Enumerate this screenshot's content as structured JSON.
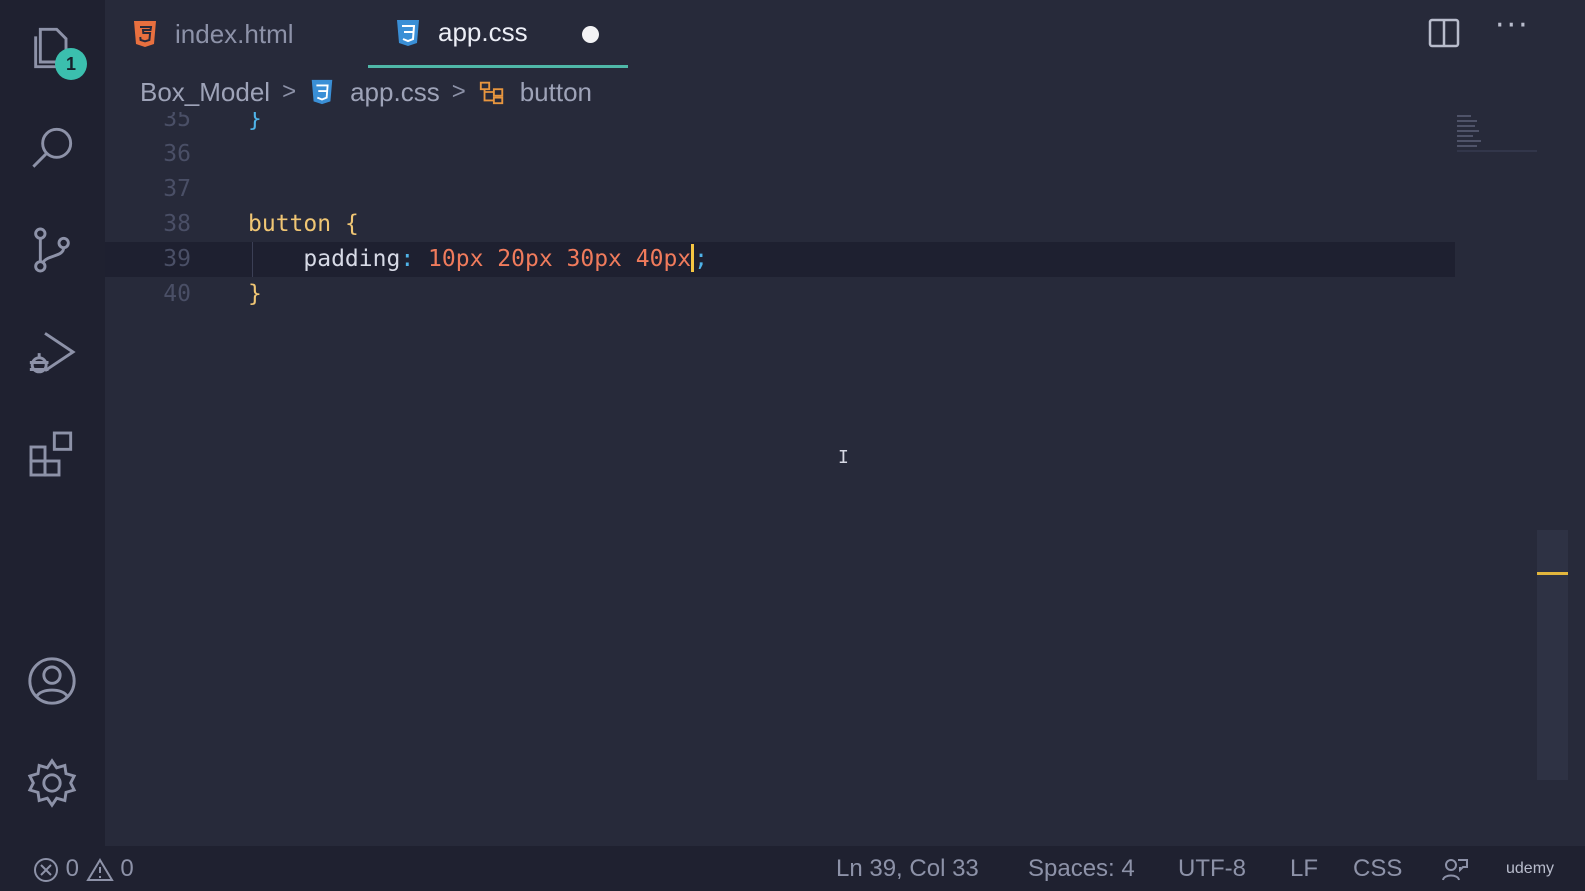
{
  "tabs": [
    {
      "label": "index.html",
      "icon": "html5-icon",
      "active": false
    },
    {
      "label": "app.css",
      "icon": "css3-icon",
      "active": true,
      "dirty": true
    }
  ],
  "activity_bar": {
    "items": [
      "explorer-icon",
      "search-icon",
      "source-control-icon",
      "run-debug-icon",
      "extensions-icon"
    ],
    "bottom": [
      "account-icon",
      "settings-gear-icon"
    ],
    "explorer_badge": "1"
  },
  "breadcrumb": [
    "Box_Model",
    "app.css",
    "button"
  ],
  "editor": {
    "lines": [
      {
        "num": "35",
        "text": "}"
      },
      {
        "num": "36",
        "text": ""
      },
      {
        "num": "37",
        "text": ""
      },
      {
        "num": "38",
        "selector": "button",
        "open": "{"
      },
      {
        "num": "39",
        "property": "padding",
        "colon": ":",
        "values": "10px 20px 30px 40px",
        "semicolon": ";"
      },
      {
        "num": "40",
        "text": "}"
      }
    ],
    "cursor": {
      "line": 39,
      "col": 33
    }
  },
  "status": {
    "errors": "0",
    "warnings": "0",
    "position": "Ln 39, Col 33",
    "spaces": "Spaces: 4",
    "encoding": "UTF-8",
    "eol": "LF",
    "language": "CSS",
    "watermark": "udemy"
  },
  "colors": {
    "editor_bg": "#272a3a",
    "activity_bg": "#1f2130",
    "accent_teal": "#4fb8a8",
    "selector": "#f0c674",
    "value": "#f07b5c",
    "bracket": "#4fb3e8"
  }
}
